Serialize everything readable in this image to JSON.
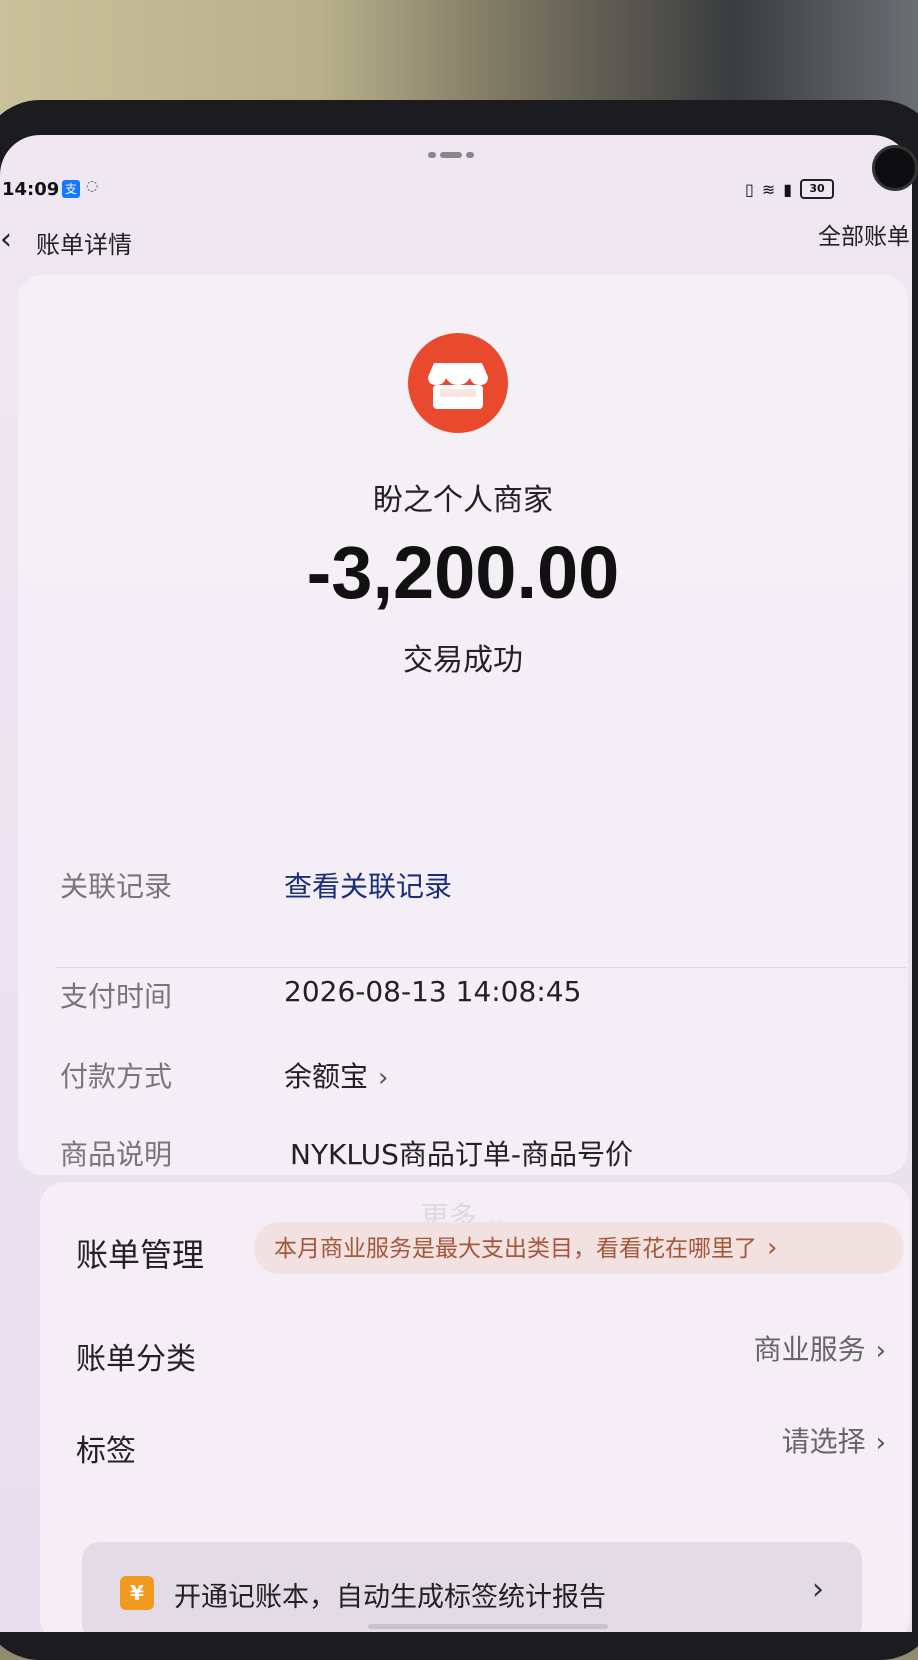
{
  "status_bar": {
    "time": "14:09",
    "app_icon": "支",
    "battery": "30"
  },
  "nav": {
    "title": "账单详情",
    "right_link": "全部账单"
  },
  "summary": {
    "merchant_name": "盼之个人商家",
    "amount": "-3,200.00",
    "status": "交易成功",
    "merchant_icon_color": "#e94a2e"
  },
  "details": {
    "related_label": "关联记录",
    "related_link": "查看关联记录",
    "pay_time_label": "支付时间",
    "pay_time_value": "2026-08-13 14:08:45",
    "pay_method_label": "付款方式",
    "pay_method_value": "余额宝",
    "desc_label": "商品说明",
    "desc_value": "NYKLUS商品订单-商品号价",
    "more_label": "更多"
  },
  "management": {
    "title": "账单管理",
    "tip": "本月商业服务是最大支出类目，看看花在哪里了",
    "category_label": "账单分类",
    "category_value": "商业服务",
    "tag_label": "标签",
    "tag_value": "请选择",
    "banner_icon": "¥",
    "banner_text": "开通记账本，自动生成标签统计报告"
  }
}
